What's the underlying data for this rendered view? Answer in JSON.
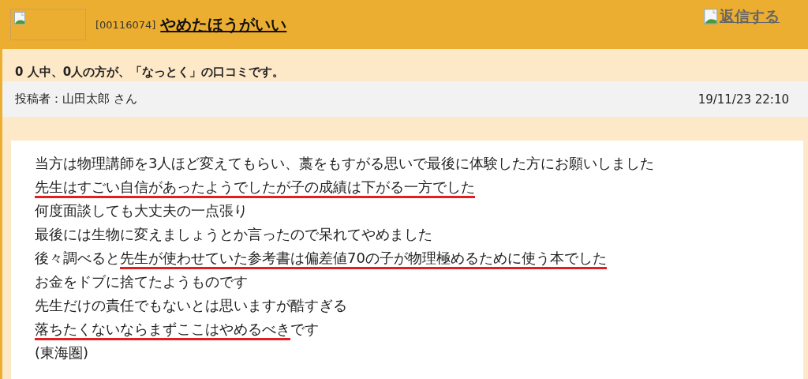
{
  "header": {
    "post_id": "[00116074]",
    "title": "やめたほうがいい",
    "reply_link": "返信する"
  },
  "summary": "0 人中、0人の方が、「なっとく」の口コミです。",
  "meta": {
    "poster": "投稿者：山田太郎 さん",
    "date": "19/11/23 22:10"
  },
  "body": [
    {
      "segments": [
        {
          "text": "当方は物理講師を3人ほど変えてもらい、藁をもすがる思いで最後に体験した方にお願いしました",
          "underlined": false
        }
      ]
    },
    {
      "segments": [
        {
          "text": "先生はすごい自信があったようでしたが子の成績は下がる一方でした",
          "underlined": true
        }
      ]
    },
    {
      "segments": [
        {
          "text": "何度面談しても大丈夫の一点張り",
          "underlined": false
        }
      ]
    },
    {
      "segments": [
        {
          "text": "最後には生物に変えましょうとか言ったので呆れてやめました",
          "underlined": false
        }
      ]
    },
    {
      "segments": [
        {
          "text": "後々調べると",
          "underlined": false
        },
        {
          "text": "先生が使わせていた参考書は偏差値70の子が物理極めるために使う本でした",
          "underlined": true
        }
      ]
    },
    {
      "segments": [
        {
          "text": "お金をドブに捨てたようものです",
          "underlined": false
        }
      ]
    },
    {
      "segments": [
        {
          "text": "先生だけの責任でもないとは思いますが酷すぎる",
          "underlined": false
        }
      ]
    },
    {
      "segments": [
        {
          "text": "落ちたくないならまずここはやめるべき",
          "underlined": true
        },
        {
          "text": "です",
          "underlined": false
        }
      ]
    },
    {
      "segments": [
        {
          "text": "(東海圏)",
          "underlined": false
        }
      ]
    }
  ]
}
